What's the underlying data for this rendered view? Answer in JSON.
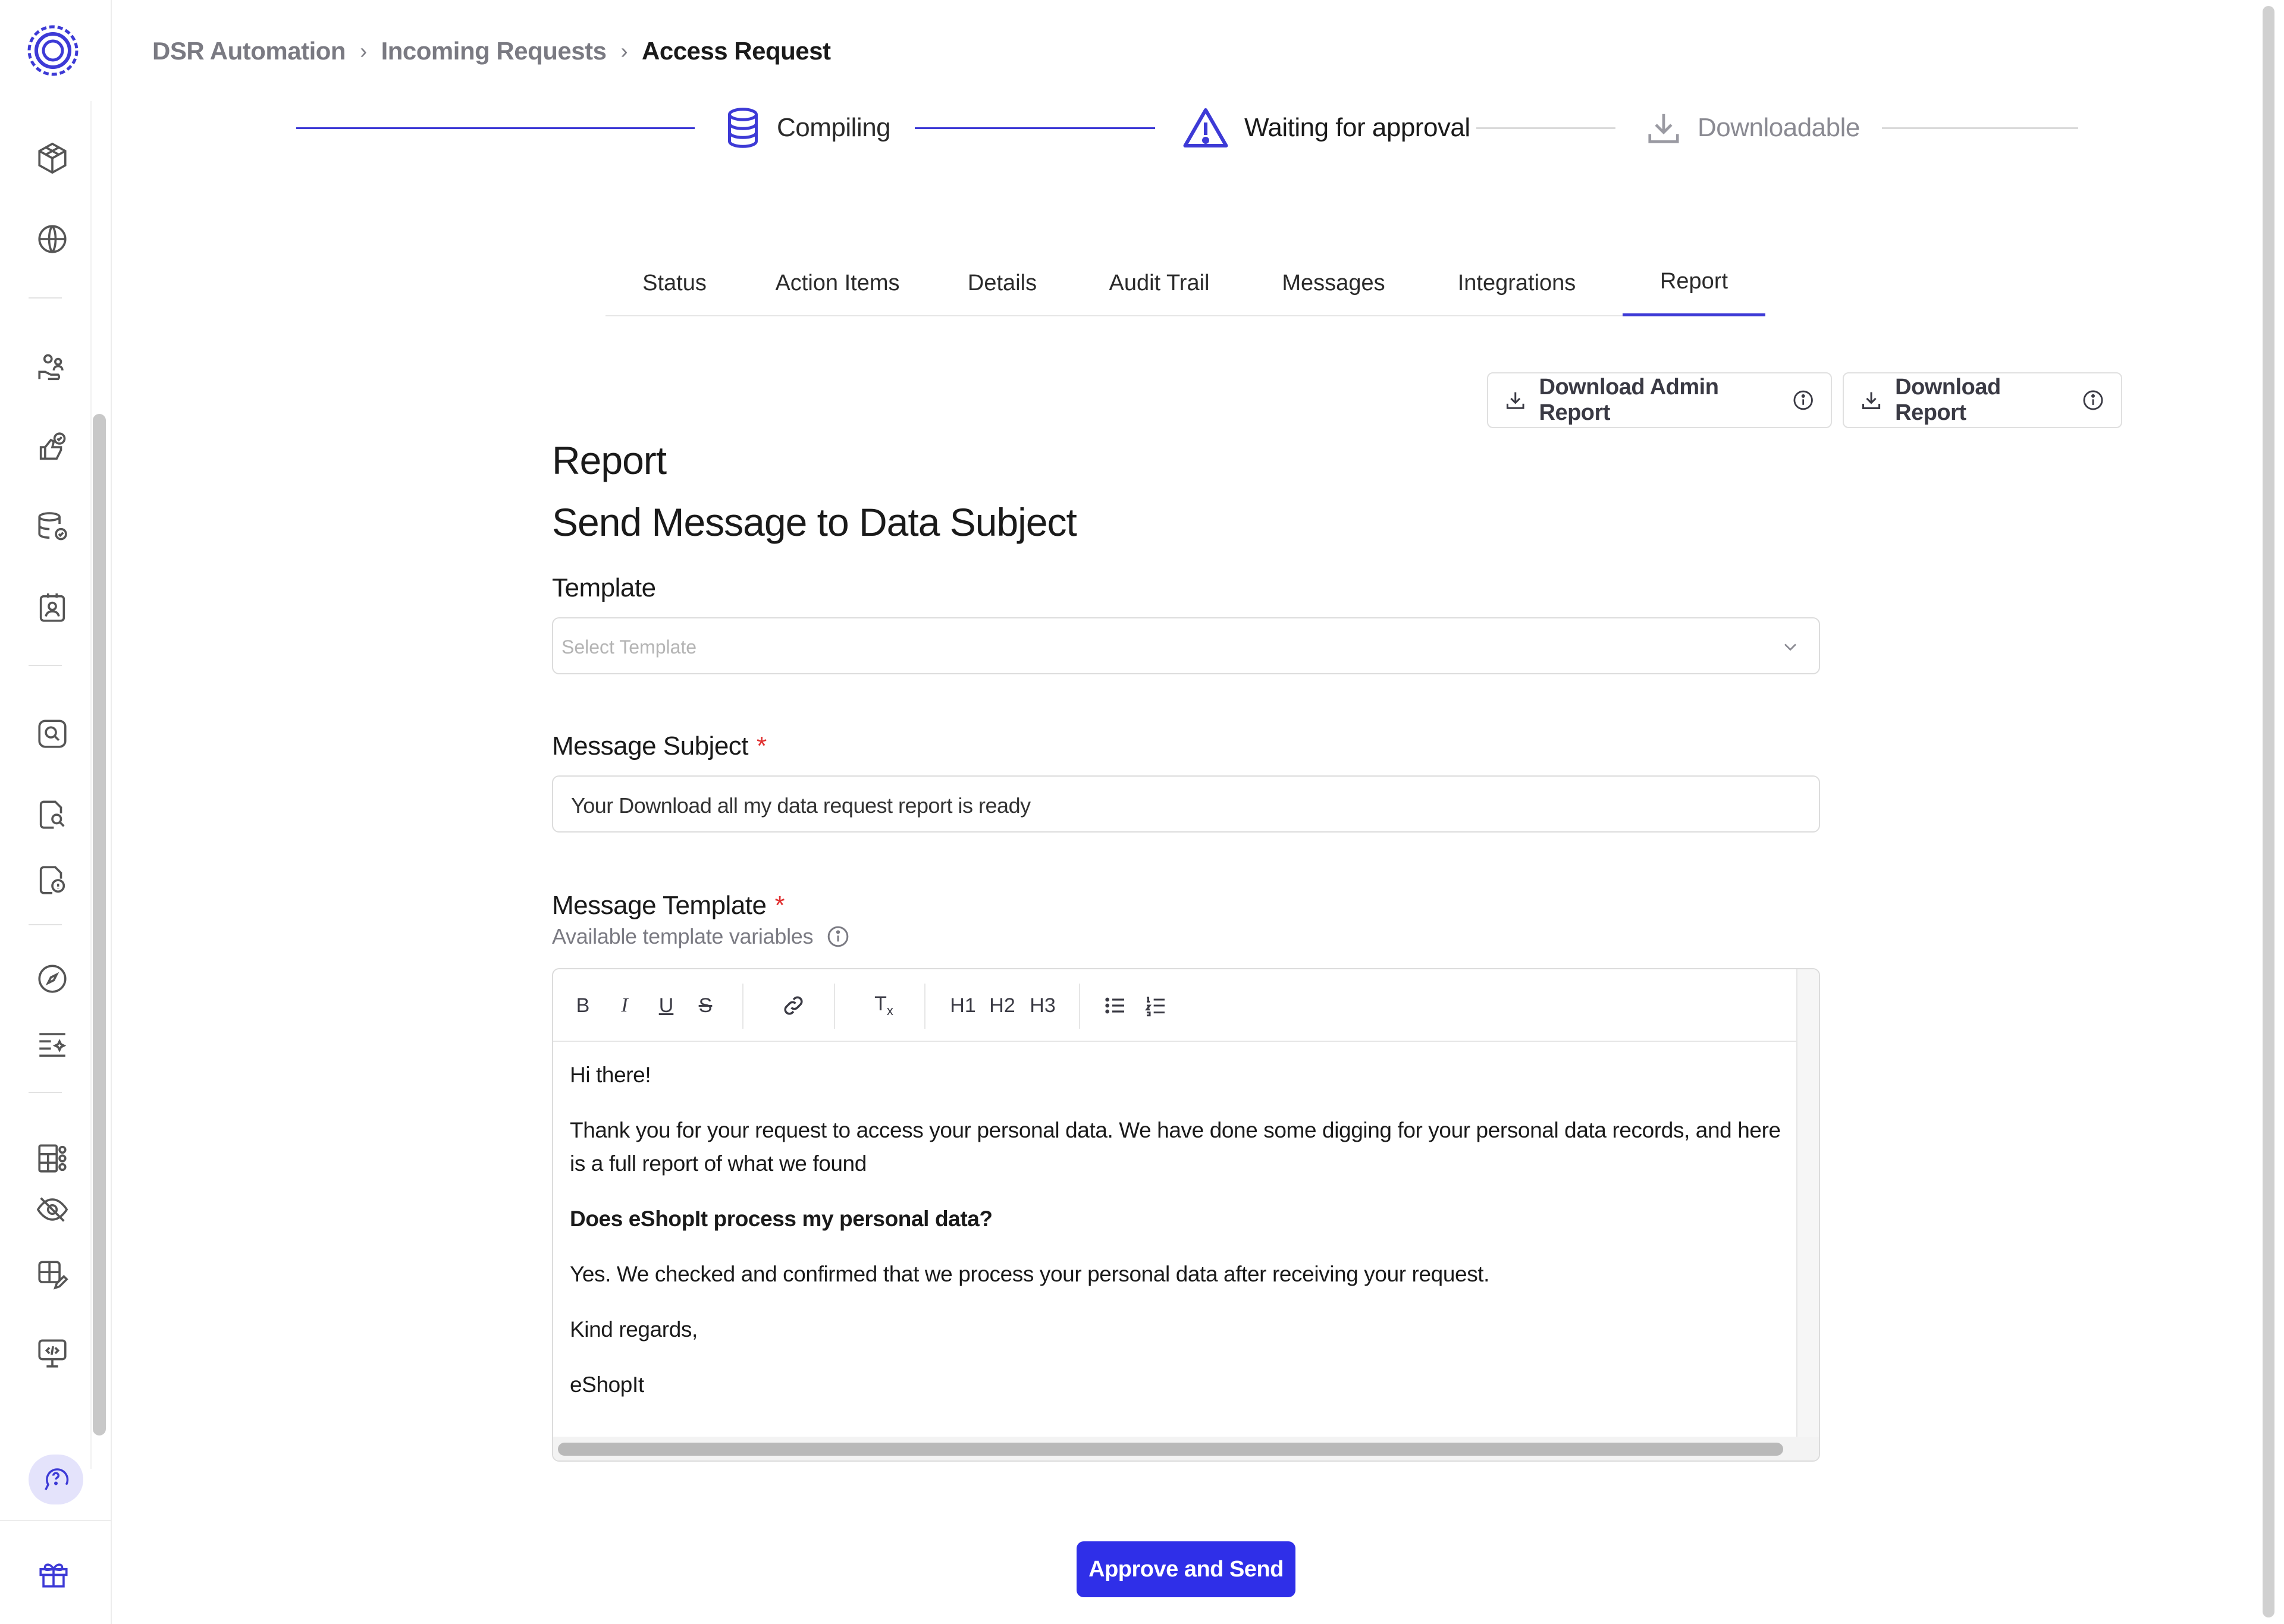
{
  "breadcrumb": {
    "items": [
      "DSR Automation",
      "Incoming Requests"
    ],
    "current": "Access Request",
    "separator": "›"
  },
  "stepper": {
    "steps": [
      {
        "label": "Compiling",
        "icon": "database-icon",
        "state": "done"
      },
      {
        "label": "Waiting for approval",
        "icon": "warning-icon",
        "state": "current"
      },
      {
        "label": "Downloadable",
        "icon": "download-icon",
        "state": "pending"
      }
    ]
  },
  "tabs": [
    {
      "label": "Status"
    },
    {
      "label": "Action Items"
    },
    {
      "label": "Details"
    },
    {
      "label": "Audit Trail"
    },
    {
      "label": "Messages"
    },
    {
      "label": "Integrations"
    },
    {
      "label": "Report",
      "active": true
    }
  ],
  "actions": {
    "download_admin_report": "Download Admin Report",
    "download_report": "Download Report"
  },
  "report": {
    "title": "Report",
    "section_title": "Send Message to Data Subject",
    "template_label": "Template",
    "template_placeholder": "Select Template",
    "subject_label": "Message Subject",
    "subject_value": "Your Download all my data request report is ready",
    "message_label": "Message Template",
    "required_mark": "*",
    "variables_hint": "Available template variables",
    "toolbar": {
      "bold": "B",
      "italic": "I",
      "underline": "U",
      "strike": "S",
      "clear_format": "Tx",
      "h1": "H1",
      "h2": "H2",
      "h3": "H3"
    },
    "body": {
      "greeting": "Hi there!",
      "intro": "Thank you for your request to access your personal data. We have done some digging for your personal data records, and here is a full report of what we found",
      "question": "Does eShopIt process my personal data?",
      "answer": "Yes. We checked and confirmed that we process your personal data after receiving your request.",
      "closing": "Kind regards,",
      "signature": "eShopIt"
    },
    "approve_button": "Approve and Send"
  },
  "sidebar": {
    "icons": [
      "logo-icon",
      "cube-icon",
      "globe-icon",
      "people-hand-icon",
      "thumb-check-icon",
      "database-check-icon",
      "contact-card-icon",
      "search-square-icon",
      "file-search-icon",
      "file-shield-icon",
      "compass-icon",
      "list-sparkle-icon",
      "apps-grid-icon",
      "eye-off-icon",
      "grid-edit-icon",
      "monitor-code-icon",
      "help-chat-icon",
      "gift-icon"
    ]
  },
  "colors": {
    "accent": "#3d3ad6",
    "primary_button": "#2f2fe8",
    "required": "#e03131",
    "muted": "#7a7a82"
  }
}
